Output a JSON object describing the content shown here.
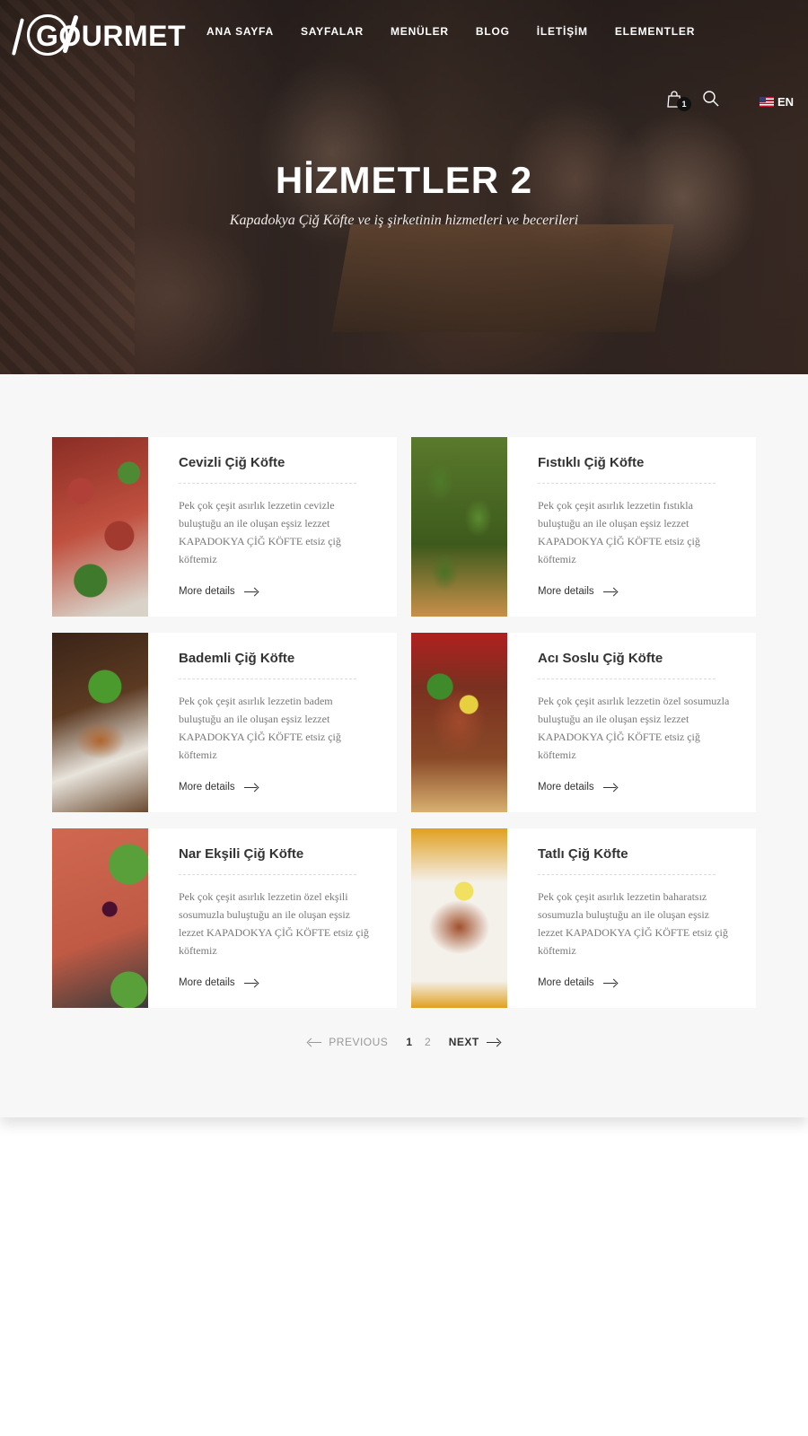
{
  "brand": {
    "logo_text": "GOURMET"
  },
  "nav": {
    "items": [
      "ANA SAYFA",
      "SAYFALAR",
      "MENÜLER",
      "BLOG",
      "İLETİŞİM",
      "ELEMENTLER"
    ]
  },
  "header_tools": {
    "cart_count": "1",
    "language": "EN",
    "cart_icon": "cart-icon",
    "search_icon": "search-icon"
  },
  "hero": {
    "title": "HİZMETLER 2",
    "subtitle": "Kapadokya Çiğ Köfte ve iş şirketinin hizmetleri ve becerileri"
  },
  "services": [
    {
      "title": "Cevizli Çiğ Köfte",
      "text": "Pek çok çeşit asırlık lezzetin cevizle buluştuğu an ile oluşan eşsiz lezzet KAPADOKYA ÇİĞ KÖFTE etsiz çiğ köftemiz",
      "link": "More details"
    },
    {
      "title": "Fıstıklı Çiğ Köfte",
      "text": "Pek çok çeşit asırlık lezzetin fıstıkla buluştuğu an ile oluşan eşsiz lezzet KAPADOKYA ÇİĞ KÖFTE etsiz çiğ köftemiz",
      "link": "More details"
    },
    {
      "title": "Bademli Çiğ Köfte",
      "text": "Pek çok çeşit asırlık lezzetin badem buluştuğu an ile oluşan eşsiz lezzet KAPADOKYA ÇİĞ KÖFTE etsiz çiğ köftemiz",
      "link": "More details"
    },
    {
      "title": "Acı Soslu Çiğ Köfte",
      "text": "Pek çok çeşit asırlık lezzetin özel sosumuzla buluştuğu an ile oluşan eşsiz lezzet KAPADOKYA ÇİĞ KÖFTE etsiz çiğ köftemiz",
      "link": "More details"
    },
    {
      "title": "Nar Ekşili Çiğ Köfte",
      "text": "Pek çok çeşit asırlık lezzetin özel ekşili sosumuzla buluştuğu an ile oluşan eşsiz lezzet KAPADOKYA ÇİĞ KÖFTE etsiz çiğ köftemiz",
      "link": "More details"
    },
    {
      "title": "Tatlı Çiğ Köfte",
      "text": "Pek çok çeşit asırlık lezzetin baharatsız sosumuzla buluştuğu an ile oluşan eşsiz lezzet KAPADOKYA ÇİĞ KÖFTE etsiz çiğ köftemiz",
      "link": "More details"
    }
  ],
  "pagination": {
    "previous": "PREVIOUS",
    "pages": [
      "1",
      "2"
    ],
    "current": "1",
    "next": "NEXT"
  }
}
